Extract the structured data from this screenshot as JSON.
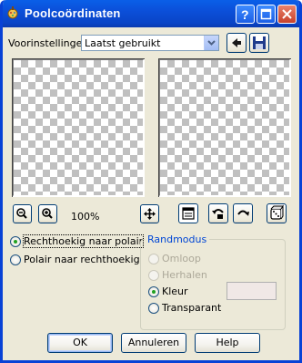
{
  "window": {
    "title": "Poolcoördinaten",
    "titlebar_buttons": [
      "help",
      "minimize",
      "close"
    ]
  },
  "presets": {
    "label": "Voorinstellingen:",
    "selected": "Laatst gebruikt"
  },
  "zoom": {
    "level": "100%"
  },
  "conversion": {
    "options": [
      {
        "label": "Rechthoekig naar polair",
        "selected": true
      },
      {
        "label": "Polair naar rechthoekig",
        "selected": false
      }
    ]
  },
  "edge_mode": {
    "legend": "Randmodus",
    "options": [
      {
        "label": "Omloop",
        "selected": false,
        "enabled": false
      },
      {
        "label": "Herhalen",
        "selected": false,
        "enabled": false
      },
      {
        "label": "Kleur",
        "selected": true,
        "enabled": true
      },
      {
        "label": "Transparant",
        "selected": false,
        "enabled": true
      }
    ],
    "color": "#f0e8e6"
  },
  "buttons": {
    "ok": "OK",
    "cancel": "Annuleren",
    "help": "Help"
  },
  "colors": {
    "title_bar": "#0b4fd9",
    "dialog_bg": "#ece9d8",
    "selected_radio": "#21a121",
    "group_legend": "#0046d5"
  }
}
